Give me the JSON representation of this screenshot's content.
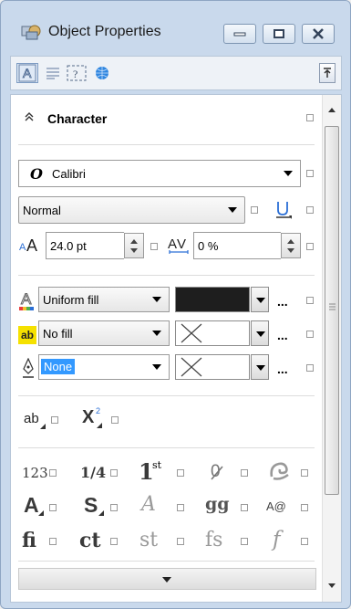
{
  "window": {
    "title": "Object Properties"
  },
  "section": {
    "title": "Character"
  },
  "font": {
    "name": "Calibri",
    "icon": "font-O-icon"
  },
  "style": {
    "value": "Normal"
  },
  "size": {
    "value": "24.0 pt"
  },
  "kerning": {
    "value": "0 %"
  },
  "fill": {
    "value": "Uniform fill",
    "color": "#1e1e1e"
  },
  "background": {
    "value": "No fill"
  },
  "outline": {
    "value": "None"
  },
  "ellipsis": "...",
  "typo_row1": [
    "ab",
    "X"
  ],
  "typo_grid": [
    [
      "123",
      "1/4",
      "1",
      "0",
      "sw"
    ],
    [
      "A",
      "S",
      "A",
      "gg",
      "A@"
    ],
    [
      "fi",
      "ct",
      "st",
      "fs",
      "f"
    ]
  ],
  "superscript": "st",
  "colors": {
    "window": "#c9d9ec",
    "selection": "#3399ff",
    "accent": "#2b6fd6"
  }
}
